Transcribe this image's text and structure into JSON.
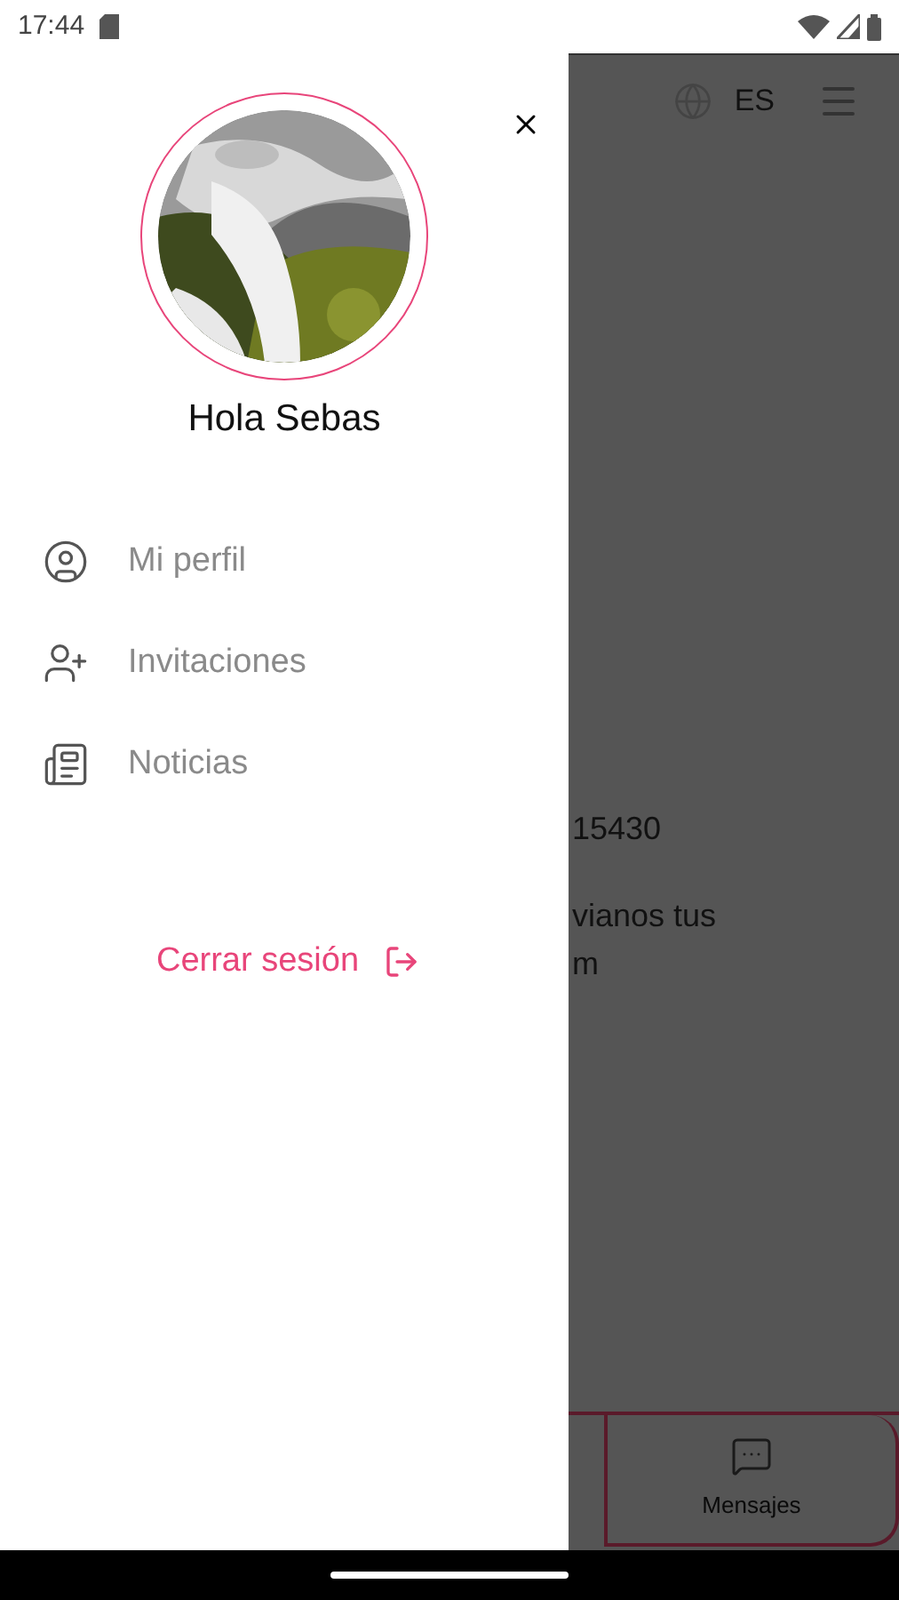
{
  "status_bar": {
    "time": "17:44"
  },
  "drawer": {
    "greeting": "Hola Sebas",
    "items": [
      {
        "kind": "profile",
        "label": "Mi perfil"
      },
      {
        "kind": "invite",
        "label": "Invitaciones"
      },
      {
        "kind": "news",
        "label": "Noticias"
      }
    ],
    "logout": "Cerrar sesión"
  },
  "background": {
    "language": "ES",
    "texts": [
      "15430",
      "vianos tus",
      "m"
    ],
    "nav_tab": "Mensajes"
  }
}
